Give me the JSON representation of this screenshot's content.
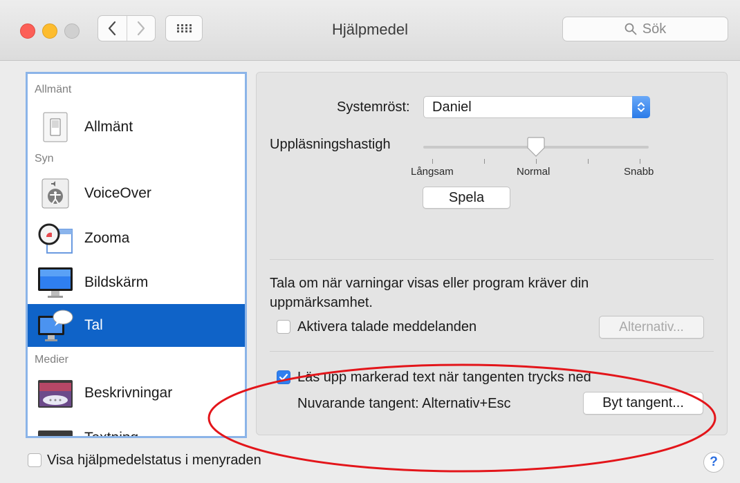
{
  "window": {
    "title": "Hjälpmedel",
    "search_placeholder": "Sök",
    "icons": {
      "back": "chevron-left-icon",
      "forward": "chevron-right-icon",
      "grid": "grid-icon",
      "search": "magnifier-icon"
    }
  },
  "sidebar": {
    "groups": {
      "general": "Allmänt",
      "vision": "Syn",
      "media": "Medier"
    },
    "items": [
      {
        "label": "Allmänt",
        "icon": "switch-icon"
      },
      {
        "label": "VoiceOver",
        "icon": "voiceover-icon"
      },
      {
        "label": "Zooma",
        "icon": "magnifier-window-icon"
      },
      {
        "label": "Bildskärm",
        "icon": "monitor-icon"
      },
      {
        "label": "Tal",
        "icon": "speech-monitor-icon",
        "selected": true
      },
      {
        "label": "Beskrivningar",
        "icon": "descriptions-icon"
      },
      {
        "label": "Textning",
        "icon": "captions-icon"
      }
    ]
  },
  "speech": {
    "system_voice_label": "Systemröst:",
    "system_voice_value": "Daniel",
    "rate_label": "Uppläsningshastigh",
    "rate_ticks": [
      "Långsam",
      "Normal",
      "Snabb"
    ],
    "rate_level_fraction": 0.5,
    "play_button": "Spela",
    "alerts_text_line1": "Tala om när varningar visas eller program kräver din",
    "alerts_text_line2": "uppmärksamhet.",
    "enable_announcements_label": "Aktivera talade meddelanden",
    "enable_announcements_checked": false,
    "options_button": "Alternativ...",
    "speak_selection_label": "Läs upp markerad text när tangenten trycks ned",
    "speak_selection_checked": true,
    "current_key_label": "Nuvarande tangent: Alternativ+Esc",
    "change_key_button": "Byt tangent..."
  },
  "footer": {
    "show_status_label": "Visa hjälpmedelstatus i menyraden",
    "show_status_checked": false,
    "help_label": "?"
  },
  "colors": {
    "selection": "#0f63c8",
    "accent": "#2f7ff0",
    "annotation": "#e3151a"
  }
}
